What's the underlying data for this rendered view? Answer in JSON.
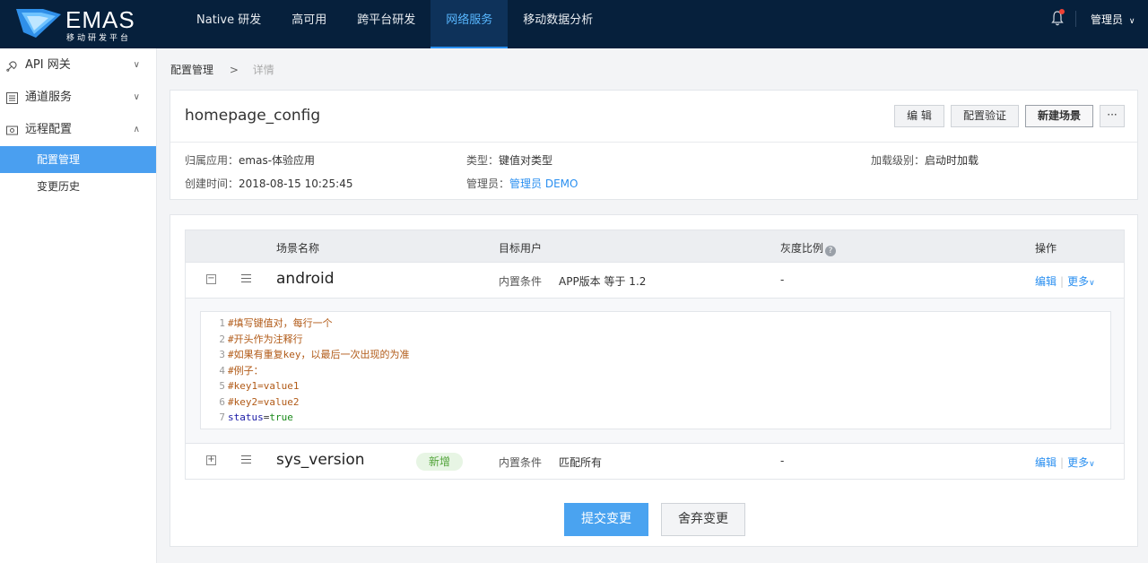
{
  "brand": {
    "name": "EMAS",
    "subtitle": "移动研发平台"
  },
  "nav": {
    "items": [
      {
        "label": "Native 研发"
      },
      {
        "label": "高可用"
      },
      {
        "label": "跨平台研发"
      },
      {
        "label": "网络服务",
        "active": true
      },
      {
        "label": "移动数据分析"
      }
    ],
    "user_label": "管理员",
    "accent_color": "#2a8ff0"
  },
  "sidebar": {
    "groups": [
      {
        "label": "API 网关",
        "icon": "api-gateway-icon",
        "chevron": "down"
      },
      {
        "label": "通道服务",
        "icon": "channel-icon",
        "chevron": "down"
      },
      {
        "label": "远程配置",
        "icon": "remote-config-icon",
        "chevron": "up"
      }
    ],
    "sub_items": [
      {
        "label": "配置管理",
        "active": true
      },
      {
        "label": "变更历史"
      }
    ]
  },
  "breadcrumb": {
    "parent": "配置管理",
    "current": "详情"
  },
  "config": {
    "name": "homepage_config",
    "buttons": {
      "edit": "编 辑",
      "validate": "配置验证",
      "new_scene": "新建场景",
      "more": "···"
    },
    "meta": {
      "app_key": "归属应用：",
      "app_val": "emas-体验应用",
      "type_key": "类型：",
      "type_val": "键值对类型",
      "load_key": "加载级别：",
      "load_val": "启动时加载",
      "created_key": "创建时间：",
      "created_val": "2018-08-15 10:25:45",
      "admin_key": "管理员：",
      "admin_val": "管理员 DEMO"
    }
  },
  "table": {
    "headers": {
      "scene": "场景名称",
      "target": "目标用户",
      "ratio": "灰度比例",
      "ops": "操作"
    },
    "rows": [
      {
        "toggle": "−",
        "name": "android",
        "cond_label": "内置条件",
        "cond_value": "APP版本 等于 1.2",
        "ratio": "-",
        "edit": "编辑",
        "more": "更多",
        "expanded": true
      },
      {
        "toggle": "+",
        "name": "sys_version",
        "badge": "新增",
        "cond_label": "内置条件",
        "cond_value": "匹配所有",
        "ratio": "-",
        "edit": "编辑",
        "more": "更多",
        "expanded": false
      }
    ],
    "code_lines": [
      {
        "num": "1",
        "text": "#填写键值对，每行一个"
      },
      {
        "num": "2",
        "text": "#开头作为注释行"
      },
      {
        "num": "3",
        "text": "#如果有重复key，以最后一次出现的为准"
      },
      {
        "num": "4",
        "text": "#例子："
      },
      {
        "num": "5",
        "text": "#key1=value1"
      },
      {
        "num": "6",
        "text": "#key2=value2"
      },
      {
        "num": "7",
        "key": "status",
        "eq": "=",
        "val": "true"
      }
    ]
  },
  "footer": {
    "submit": "提交变更",
    "discard": "舍弃变更"
  }
}
